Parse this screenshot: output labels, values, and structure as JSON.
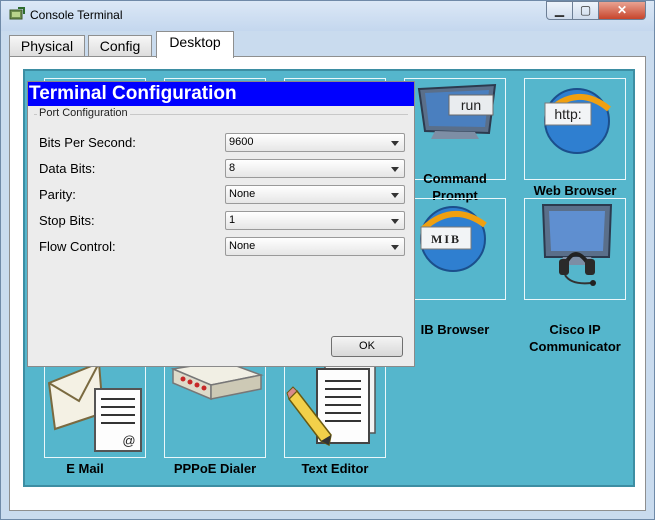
{
  "window": {
    "title": "Console Terminal",
    "controls": {
      "minimize": "▁",
      "maximize": "▢",
      "close": "✕"
    }
  },
  "tabs": [
    {
      "label": "Physical",
      "active": false
    },
    {
      "label": "Config",
      "active": false
    },
    {
      "label": "Desktop",
      "active": true
    }
  ],
  "desktop": {
    "apps": {
      "command_prompt": {
        "label": "Command Prompt",
        "icon": "command-prompt-icon",
        "icon_text": "run"
      },
      "web_browser": {
        "label": "Web Browser",
        "icon": "web-browser-icon",
        "icon_text": "http:"
      },
      "mib_browser": {
        "label": "IB Browser",
        "icon": "mib-browser-icon",
        "icon_text": "MIB"
      },
      "cisco_ip_communicator": {
        "label": "Cisco IP Communicator",
        "icon": "ip-communicator-icon"
      },
      "email": {
        "label": "E Mail",
        "icon": "email-icon",
        "icon_text": "@"
      },
      "pppoe_dialer": {
        "label": "PPPoE Dialer",
        "icon": "pppoe-dialer-icon"
      },
      "text_editor": {
        "label": "Text Editor",
        "icon": "text-editor-icon"
      }
    }
  },
  "terminal_config": {
    "title": "Terminal Configuration",
    "group_label": "Port Configuration",
    "fields": [
      {
        "label": "Bits Per Second:",
        "value": "9600"
      },
      {
        "label": "Data Bits:",
        "value": "8"
      },
      {
        "label": "Parity:",
        "value": "None"
      },
      {
        "label": "Stop Bits:",
        "value": "1"
      },
      {
        "label": "Flow Control:",
        "value": "None"
      }
    ],
    "ok_label": "OK"
  },
  "colors": {
    "desktop_bg": "#55b6cc",
    "dialog_title_bg": "#0000ff",
    "close_button": "#c7452c"
  }
}
